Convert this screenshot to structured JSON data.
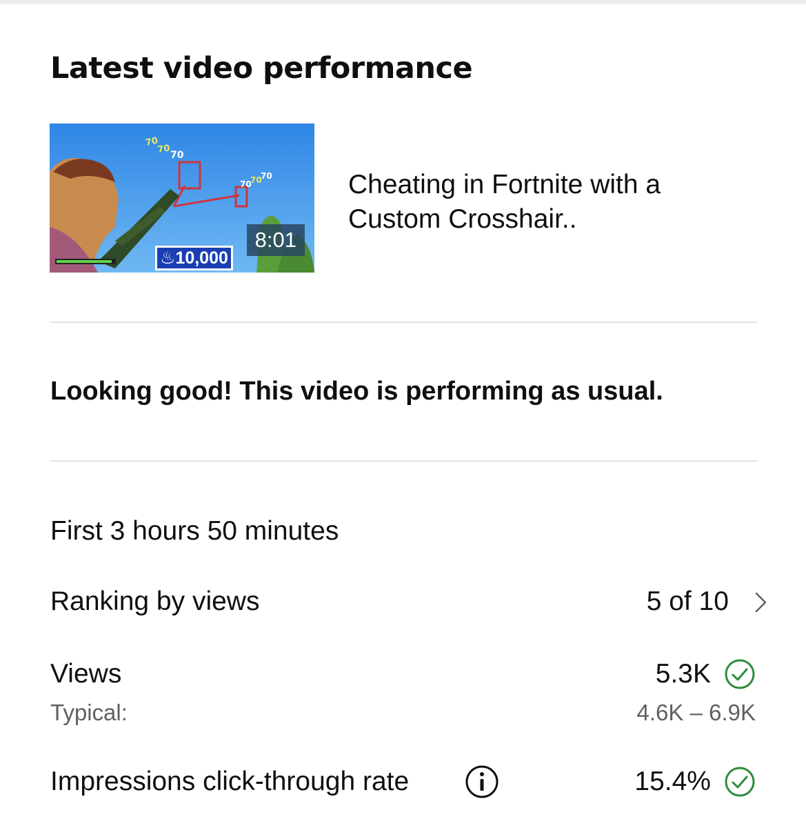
{
  "card": {
    "title": "Latest video performance"
  },
  "video": {
    "title": "Cheating in Fortnite with a Custom Crosshair..",
    "duration": "8:01",
    "thumbnail_badge": "10,000",
    "thumbnail_damage_numbers": [
      "70",
      "70",
      "70",
      "70",
      "70",
      "70"
    ]
  },
  "status_message": "Looking good! This video is performing as usual.",
  "period": "First 3 hours 50 minutes",
  "metrics": {
    "ranking": {
      "label": "Ranking by views",
      "value": "5 of 10",
      "icon": "chevron-right-icon"
    },
    "views": {
      "label": "Views",
      "value": "5.3K",
      "typical_label": "Typical:",
      "typical_range": "4.6K – 6.9K",
      "icon": "check-circle-icon"
    },
    "ctr": {
      "label": "Impressions click-through rate",
      "value": "15.4%",
      "info_icon": "info-icon",
      "icon": "check-circle-icon"
    }
  },
  "colors": {
    "check_green": "#2e8b3a",
    "divider": "#e3e3e3",
    "secondary_text": "#606060"
  }
}
